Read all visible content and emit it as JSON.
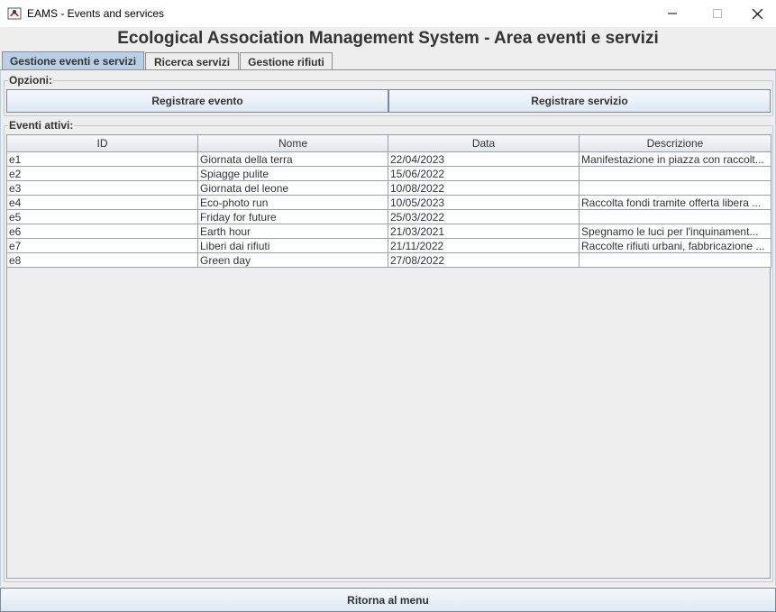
{
  "window": {
    "title": "EAMS - Events and services",
    "icon": "java-app-icon"
  },
  "header": {
    "title": "Ecological Association Management System - Area eventi e servizi"
  },
  "tabs": [
    {
      "label": "Gestione eventi e servizi",
      "active": true
    },
    {
      "label": "Ricerca servizi",
      "active": false
    },
    {
      "label": "Gestione rifiuti",
      "active": false
    }
  ],
  "options": {
    "label": "Opzioni:",
    "register_event": "Registrare evento",
    "register_service": "Registrare servizio"
  },
  "events": {
    "label": "Eventi attivi:",
    "columns": [
      "ID",
      "Nome",
      "Data",
      "Descrizione"
    ],
    "rows": [
      [
        "e1",
        "Giornata della terra",
        "22/04/2023",
        "Manifestazione in piazza con raccolt..."
      ],
      [
        "e2",
        "Spiagge pulite",
        "15/06/2022",
        ""
      ],
      [
        "e3",
        "Giornata del leone",
        "10/08/2022",
        ""
      ],
      [
        "e4",
        "Eco-photo run",
        "10/05/2023",
        "Raccolta fondi tramite offerta libera ..."
      ],
      [
        "e5",
        "Friday for future",
        "25/03/2022",
        ""
      ],
      [
        "e6",
        "Earth hour",
        "21/03/2021",
        "Spegnamo le luci per l'inquinament..."
      ],
      [
        "e7",
        "Liberi dai rifiuti",
        "21/11/2022",
        "Raccolte rifiuti urbani, fabbricazione ..."
      ],
      [
        "e8",
        "Green day",
        "27/08/2022",
        ""
      ]
    ]
  },
  "footer": {
    "back_label": "Ritorna al menu"
  },
  "colors": {
    "active_tab": "#b8cfe5",
    "background": "#eeeeee"
  }
}
